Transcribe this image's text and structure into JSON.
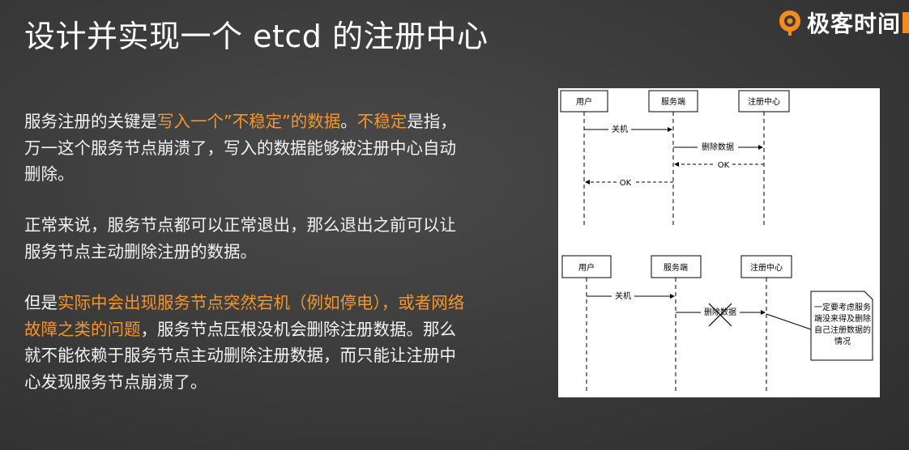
{
  "title": "设计并实现一个 etcd 的注册中心",
  "logo": {
    "text": "极客时间",
    "accent": "#f58a1f"
  },
  "highlight_color": "#f5952c",
  "paragraphs": [
    {
      "s1": "服务注册的关键是",
      "h1": "写入一个”不稳定”的数据",
      "s2": "。",
      "h2": "不稳定",
      "s3": "是指，万一这个服务节点崩溃了，写入的数据能够被注册中心自动删除。"
    },
    {
      "s1": "正常来说，服务节点都可以正常退出，那么退出之前可以让服务节点主动删除注册的数据。"
    },
    {
      "s1": "但是",
      "h1": "实际中会出现服务节点突然宕机（例如停电），或者网络故障之类的问题",
      "s2": "，服务节点压根没机会删除注册数据。那么就不能依赖于服务节点主动删除注册数据，而只能让注册中心发现服务节点崩溃了。"
    }
  ],
  "diagram": {
    "top": {
      "actors": [
        "用户",
        "服务端",
        "注册中心"
      ],
      "msg_shutdown": "关机",
      "msg_delete": "删除数据",
      "msg_ok_1": "OK",
      "msg_ok_2": "OK"
    },
    "bottom": {
      "actors": [
        "用户",
        "服务端",
        "注册中心"
      ],
      "msg_shutdown": "关机",
      "msg_delete": "删除数据",
      "note_lines": [
        "一定要考虑服务",
        "端没来得及删除",
        "自己注册数据的",
        "情况"
      ]
    }
  }
}
